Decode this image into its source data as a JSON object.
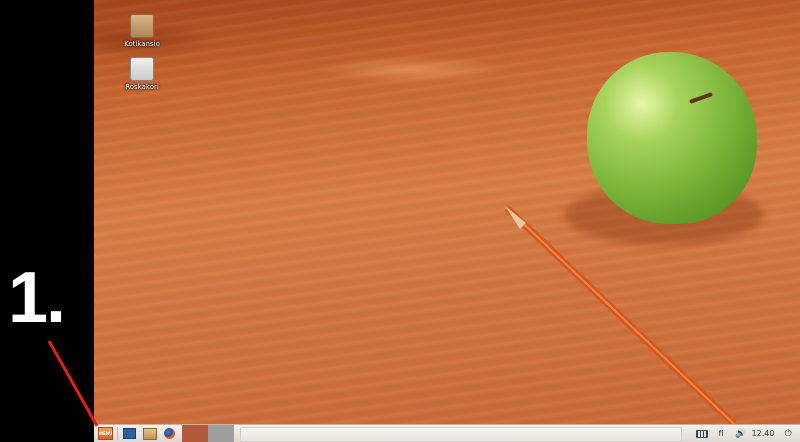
{
  "annotation": {
    "step_label": "1."
  },
  "desktop": {
    "icons": [
      {
        "label": "Kotikansio",
        "icon": "home-folder-icon"
      },
      {
        "label": "Roskakori",
        "icon": "trash-icon"
      }
    ]
  },
  "taskbar": {
    "menu_label": "MENU",
    "launchers": [
      "show-desktop-icon",
      "files-icon",
      "firefox-icon"
    ],
    "workspaces": 2,
    "tray": {
      "keyboard_layout": "fi",
      "clock": "12.40"
    }
  },
  "colors": {
    "annotation_line": "#e41e1e",
    "taskbar_bg": "#ece9e4",
    "workspace_active": "#b35a3c",
    "workspace_inactive": "#9e9e9e"
  }
}
